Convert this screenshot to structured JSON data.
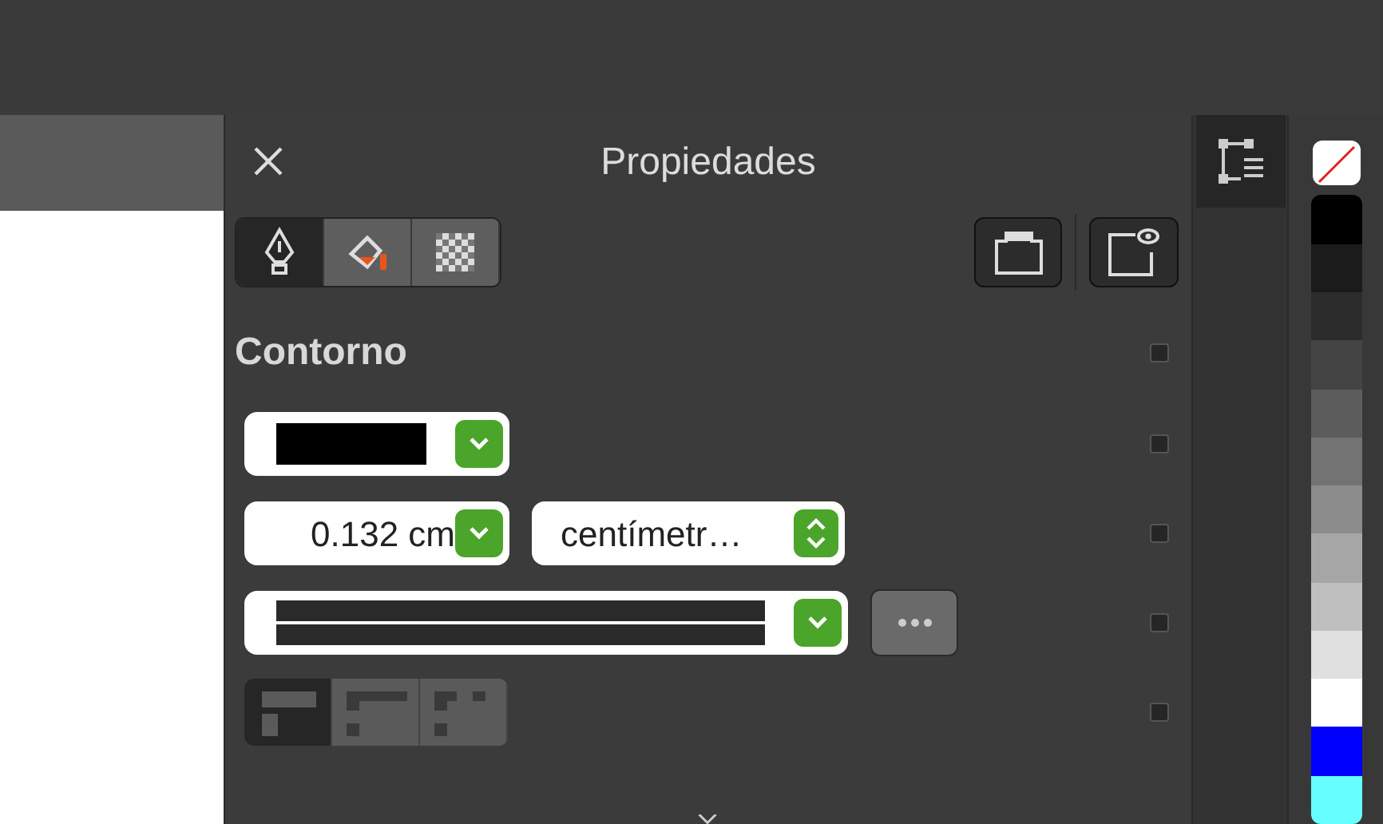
{
  "panel": {
    "title": "Propiedades"
  },
  "tabs": [
    {
      "kind": "outline",
      "selected": true
    },
    {
      "kind": "fill",
      "selected": false
    },
    {
      "kind": "transparency",
      "selected": false
    }
  ],
  "section": {
    "title": "Contorno"
  },
  "width_field": {
    "value": "0.132 cm"
  },
  "units_field": {
    "value": "centímetr…"
  },
  "row_checks": [
    {
      "checked": false
    },
    {
      "checked": false
    },
    {
      "checked": false
    },
    {
      "checked": false
    },
    {
      "checked": false
    }
  ],
  "joins": [
    {
      "kind": "miter",
      "selected": true
    },
    {
      "kind": "round",
      "selected": false
    },
    {
      "kind": "bevel",
      "selected": false
    }
  ],
  "palette": [
    {
      "color": "#000000"
    },
    {
      "color": "#1b1b1b"
    },
    {
      "color": "#2c2c2c"
    },
    {
      "color": "#444444"
    },
    {
      "color": "#5c5c5c"
    },
    {
      "color": "#737373"
    },
    {
      "color": "#8c8c8c"
    },
    {
      "color": "#a6a6a6"
    },
    {
      "color": "#bfbfbf"
    },
    {
      "color": "#e0e0e0"
    },
    {
      "color": "#ffffff"
    },
    {
      "color": "#0000ff"
    },
    {
      "color": "#66ffff"
    }
  ]
}
